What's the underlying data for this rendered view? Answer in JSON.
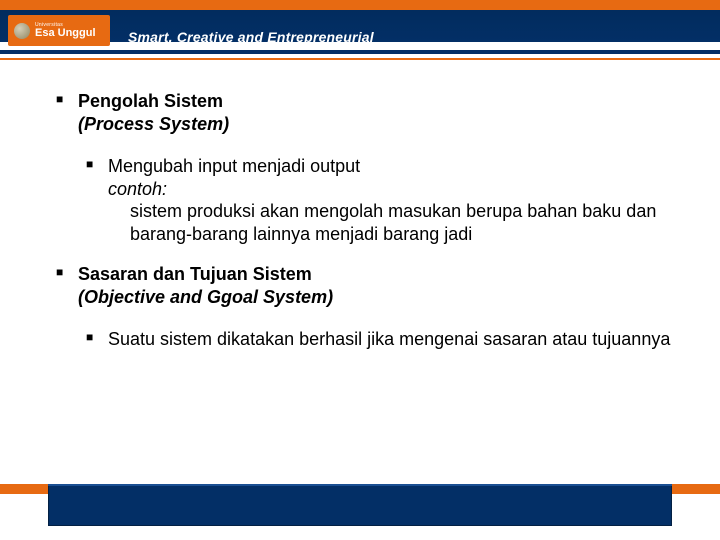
{
  "brand": {
    "top_small": "Universitas",
    "name": "Esa Unggul",
    "tagline": "Smart, Creative and Entrepreneurial"
  },
  "bullets": {
    "b1_title": "Pengolah Sistem",
    "b1_sub": "(Process System)",
    "b1_c1_line1": "Mengubah input menjadi output",
    "b1_c1_line2": "contoh:",
    "b1_c1_line3": "sistem produksi akan mengolah masukan berupa bahan baku dan barang-barang lainnya menjadi barang jadi",
    "b2_title": "Sasaran dan Tujuan Sistem",
    "b2_sub": "(Objective and Ggoal System)",
    "b2_c1": "Suatu sistem dikatakan berhasil jika mengenai sasaran atau tujuannya"
  }
}
